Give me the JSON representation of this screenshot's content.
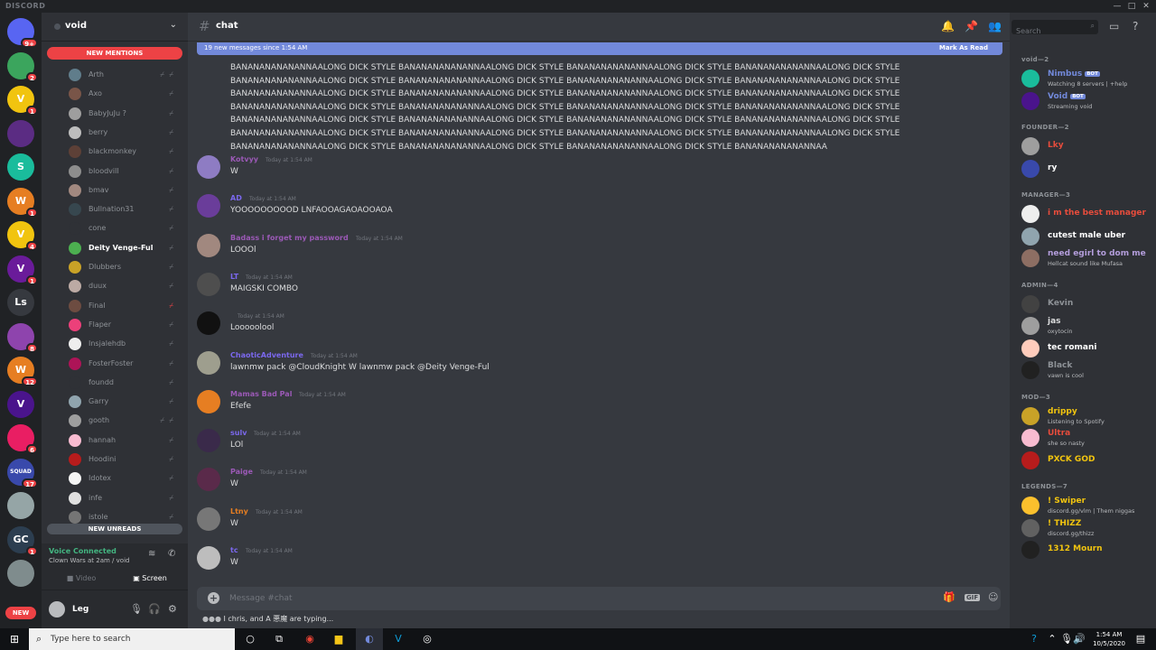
{
  "app": {
    "title": "DISCORD"
  },
  "servers": [
    {
      "label": "",
      "badge": "9+",
      "color": "#5865f2"
    },
    {
      "label": "",
      "badge": "2",
      "color": "#3ba55d"
    },
    {
      "label": "V",
      "badge": "1",
      "color": "#f1c40f"
    },
    {
      "label": "",
      "badge": "",
      "color": "#5b2c83"
    },
    {
      "label": "S",
      "badge": "",
      "color": "#1abc9c"
    },
    {
      "label": "W",
      "badge": "1",
      "color": "#e67e22"
    },
    {
      "label": "V",
      "badge": "4",
      "color": "#f1c40f"
    },
    {
      "label": "V",
      "badge": "1",
      "color": "#6a1b9a"
    },
    {
      "label": "Ls",
      "badge": "",
      "color": "#36393f"
    },
    {
      "label": "",
      "badge": "8",
      "color": "#8e44ad"
    },
    {
      "label": "W",
      "badge": "12",
      "color": "#e67e22"
    },
    {
      "label": "V",
      "badge": "",
      "color": "#4a148c"
    },
    {
      "label": "",
      "badge": "6",
      "color": "#e91e63"
    },
    {
      "label": "SQUAD",
      "badge": "17",
      "color": "#3949ab"
    },
    {
      "label": "",
      "badge": "",
      "color": "#95a5a6"
    },
    {
      "label": "GC",
      "badge": "1",
      "color": "#2c3e50"
    },
    {
      "label": "",
      "badge": "",
      "color": "#7f8c8d"
    }
  ],
  "new_pill": "NEW",
  "guild": {
    "name": "void",
    "new_mentions": "NEW MENTIONS",
    "new_unreads": "NEW UNREADS"
  },
  "voice_users": [
    {
      "name": "Arth",
      "color": "#607d8b",
      "double": true,
      "highlight": false,
      "red": false
    },
    {
      "name": "Axo",
      "color": "#795548",
      "double": false,
      "highlight": false,
      "red": false
    },
    {
      "name": "BabyJuJu ?",
      "color": "#9e9e9e",
      "double": false,
      "highlight": false,
      "red": false
    },
    {
      "name": "berry",
      "color": "#bdbdbd",
      "double": false,
      "highlight": false,
      "red": false
    },
    {
      "name": "blackmonkey",
      "color": "#5d4037",
      "double": false,
      "highlight": false,
      "red": false
    },
    {
      "name": "bloodvill",
      "color": "#8d8d8d",
      "double": false,
      "highlight": false,
      "red": false
    },
    {
      "name": "bmav",
      "color": "#a1887f",
      "double": false,
      "highlight": false,
      "red": false
    },
    {
      "name": "Bullnation31",
      "color": "#37474f",
      "double": false,
      "highlight": false,
      "red": false
    },
    {
      "name": "cone",
      "color": "#2f3136",
      "double": false,
      "highlight": false,
      "red": false
    },
    {
      "name": "Deity Venge-Ful",
      "color": "#4caf50",
      "double": false,
      "highlight": true,
      "red": false
    },
    {
      "name": "Dlubbers",
      "color": "#c9a227",
      "double": false,
      "highlight": false,
      "red": false
    },
    {
      "name": "duux",
      "color": "#bcaaa4",
      "double": false,
      "highlight": false,
      "red": false
    },
    {
      "name": "Final",
      "color": "#6d4c41",
      "double": false,
      "highlight": false,
      "red": true
    },
    {
      "name": "Flaper",
      "color": "#ec407a",
      "double": false,
      "highlight": false,
      "red": false
    },
    {
      "name": "Insjalehdb",
      "color": "#eeeeee",
      "double": false,
      "highlight": false,
      "red": false
    },
    {
      "name": "FosterFoster",
      "color": "#ad1457",
      "double": false,
      "highlight": false,
      "red": false
    },
    {
      "name": "foundd",
      "color": "#2f3136",
      "double": false,
      "highlight": false,
      "red": false
    },
    {
      "name": "Garry",
      "color": "#90a4ae",
      "double": false,
      "highlight": false,
      "red": false
    },
    {
      "name": "gooth",
      "color": "#9e9e9e",
      "double": true,
      "highlight": false,
      "red": false
    },
    {
      "name": "hannah",
      "color": "#f8bbd0",
      "double": false,
      "highlight": false,
      "red": false
    },
    {
      "name": "Hoodini",
      "color": "#b71c1c",
      "double": false,
      "highlight": false,
      "red": false
    },
    {
      "name": "Idotex",
      "color": "#f5f5f5",
      "double": false,
      "highlight": false,
      "red": false
    },
    {
      "name": "infe",
      "color": "#e0e0e0",
      "double": false,
      "highlight": false,
      "red": false
    },
    {
      "name": "istole",
      "color": "#757575",
      "double": false,
      "highlight": false,
      "red": false
    }
  ],
  "voice_panel": {
    "status": "Voice Connected",
    "channel": "Clown Wars at 2am / void",
    "video": "Video",
    "screen": "Screen"
  },
  "user_panel": {
    "name": "Leg"
  },
  "chat": {
    "channel": "chat",
    "new_messages": "19 new messages since 1:54 AM",
    "mark_as_read": "Mark As Read",
    "spam_lines": [
      "BANANANANANANNAALONG DICK STYLE BANANANANANANNAALONG DICK STYLE BANANANANANANNAALONG DICK STYLE BANANANANANANNAALONG DICK STYLE",
      "BANANANANANANNAALONG DICK STYLE BANANANANANANNAALONG DICK STYLE BANANANANANANNAALONG DICK STYLE BANANANANANANNAALONG DICK STYLE",
      "BANANANANANANNAALONG DICK STYLE BANANANANANANNAALONG DICK STYLE BANANANANANANNAALONG DICK STYLE BANANANANANANNAALONG DICK STYLE",
      "BANANANANANANNAALONG DICK STYLE BANANANANANANNAALONG DICK STYLE BANANANANANANNAALONG DICK STYLE BANANANANANANNAALONG DICK STYLE",
      "BANANANANANANNAALONG DICK STYLE BANANANANANANNAALONG DICK STYLE BANANANANANANNAALONG DICK STYLE BANANANANANANNAALONG DICK STYLE",
      "BANANANANANANNAALONG DICK STYLE BANANANANANANNAALONG DICK STYLE BANANANANANANNAALONG DICK STYLE BANANANANANANNAALONG DICK STYLE",
      "BANANANANANANNAALONG DICK STYLE BANANANANANANNAALONG DICK STYLE BANANANANANANNAALONG DICK STYLE BANANANANANANNAA"
    ],
    "messages": [
      {
        "author": "Kotvyy",
        "author_color": "#9b59b6",
        "time": "Today at 1:54 AM",
        "text": "W",
        "avatar": "#8e7cc3"
      },
      {
        "author": "AD",
        "author_color": "#7b68ee",
        "time": "Today at 1:54 AM",
        "text": "YOOOOOOOOOD LNFAOOAGAOAOOAOA",
        "avatar": "#6a3d9a"
      },
      {
        "author": "Badass i forget my password",
        "author_color": "#9b59b6",
        "time": "Today at 1:54 AM",
        "text": "LOOOl",
        "avatar": "#a1887f"
      },
      {
        "author": "LT",
        "author_color": "#7b68ee",
        "time": "Today at 1:54 AM",
        "text": "MAIGSKI COMBO",
        "avatar": "#4e4e4e"
      },
      {
        "author": "",
        "author_color": "#9b59b6",
        "time": "Today at 1:54 AM",
        "text": "Looooolool",
        "avatar": "#111111"
      },
      {
        "author": "ChaoticAdventure",
        "author_color": "#7b68ee",
        "time": "Today at 1:54 AM",
        "text": "lawnmw pack @CloudKnight W lawnmw pack @Deity Venge-Ful",
        "avatar": "#9e9e8e"
      },
      {
        "author": "Mamas Bad Pal",
        "author_color": "#9b59b6",
        "time": "Today at 1:54 AM",
        "text": "Efefe",
        "avatar": "#e67e22"
      },
      {
        "author": "sulv",
        "author_color": "#7b68ee",
        "time": "Today at 1:54 AM",
        "text": "LOl",
        "avatar": "#3a2a4a"
      },
      {
        "author": "Paige",
        "author_color": "#9b59b6",
        "time": "Today at 1:54 AM",
        "text": "W",
        "avatar": "#5a2a4a"
      },
      {
        "author": "Ltny",
        "author_color": "#e67e22",
        "time": "Today at 1:54 AM",
        "text": "W",
        "avatar": "#777777"
      },
      {
        "author": "tc",
        "author_color": "#7b68ee",
        "time": "Today at 1:54 AM",
        "text": "W",
        "avatar": "#bdbdbd"
      }
    ],
    "composer_placeholder": "Message #chat",
    "typing": "I chris, and A 悪魔 are typing..."
  },
  "members": {
    "search_placeholder": "Search",
    "groups": [
      {
        "title": "void—2",
        "items": [
          {
            "name": "Nimbus",
            "status": "Watching 8 servers | +help",
            "color": "#7289da",
            "bot": "BOT",
            "avatar": "#1abc9c"
          },
          {
            "name": "Void",
            "status": "Streaming void",
            "color": "#7289da",
            "bot": "BOT",
            "avatar": "#4a148c"
          }
        ]
      },
      {
        "title": "FOUNDER—2",
        "items": [
          {
            "name": "Lky",
            "status": "",
            "color": "#e74c3c",
            "bot": "",
            "avatar": "#9e9e9e"
          },
          {
            "name": "ry",
            "status": "",
            "color": "#ffffff",
            "bot": "",
            "avatar": "#3949ab"
          }
        ]
      },
      {
        "title": "MANAGER—3",
        "items": [
          {
            "name": "i m the best manager",
            "status": "",
            "color": "#e74c3c",
            "bot": "",
            "avatar": "#eeeeee"
          },
          {
            "name": "cutest male uber",
            "status": "",
            "color": "#ffffff",
            "bot": "",
            "avatar": "#90a4ae"
          },
          {
            "name": "need egirl to dom me",
            "status": "Hellcat sound like Mufasa",
            "color": "#b39ddb",
            "bot": "",
            "avatar": "#8d6e63"
          }
        ]
      },
      {
        "title": "ADMIN—4",
        "items": [
          {
            "name": "Kevin",
            "status": "",
            "color": "#8e9297",
            "bot": "",
            "avatar": "#424242"
          },
          {
            "name": "jas",
            "status": "oxytocin",
            "color": "#dcddde",
            "bot": "",
            "avatar": "#9e9e9e"
          },
          {
            "name": "tec romani",
            "status": "",
            "color": "#ffffff",
            "bot": "",
            "avatar": "#ffccbc"
          },
          {
            "name": "Black",
            "status": "vawn is cool",
            "color": "#8e9297",
            "bot": "",
            "avatar": "#212121"
          }
        ]
      },
      {
        "title": "MOD—3",
        "items": [
          {
            "name": "drippy",
            "status": "Listening to Spotify",
            "color": "#f1c40f",
            "bot": "",
            "avatar": "#c9a227"
          },
          {
            "name": "Ultra",
            "status": "she so nasty",
            "color": "#e74c3c",
            "bot": "",
            "avatar": "#f8bbd0"
          },
          {
            "name": "PXCK GOD",
            "status": "",
            "color": "#f1c40f",
            "bot": "",
            "avatar": "#b71c1c"
          }
        ]
      },
      {
        "title": "LEGENDS—7",
        "items": [
          {
            "name": "! Swiper",
            "status": "discord.gg/vlm | Them niggas",
            "color": "#f1c40f",
            "bot": "",
            "avatar": "#fbc02d"
          },
          {
            "name": "! THIZZ",
            "status": "discord.gg/thizz",
            "color": "#f1c40f",
            "bot": "",
            "avatar": "#616161"
          },
          {
            "name": "1312 Mourn",
            "status": "",
            "color": "#f1c40f",
            "bot": "",
            "avatar": "#212121"
          }
        ]
      }
    ]
  },
  "taskbar": {
    "search_placeholder": "Type here to search",
    "time": "1:54 AM",
    "date": "10/5/2020"
  }
}
